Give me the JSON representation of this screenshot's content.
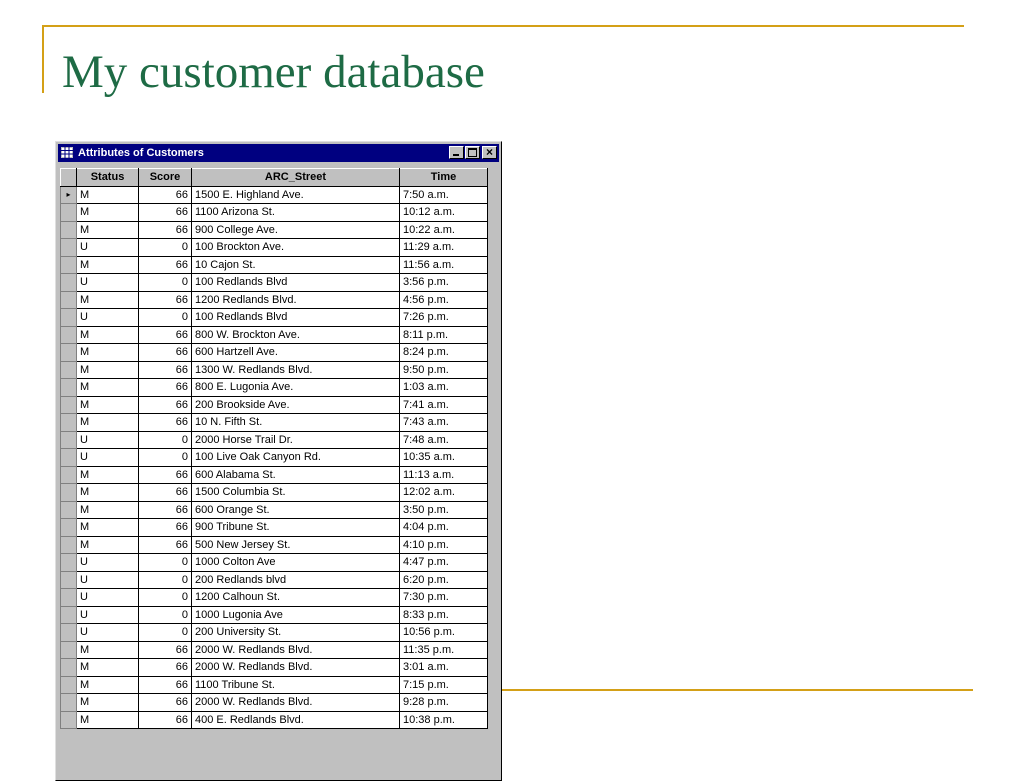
{
  "slide": {
    "title": "My customer database"
  },
  "window": {
    "title": "Attributes of Customers",
    "close_glyph": "×"
  },
  "table": {
    "columns": [
      "Status",
      "Score",
      "ARC_Street",
      "Time"
    ],
    "current_row_marker": "▸",
    "rows": [
      [
        "M",
        "66",
        "1500  E. Highland Ave.",
        "7:50 a.m."
      ],
      [
        "M",
        "66",
        "1100  Arizona St.",
        "10:12 a.m."
      ],
      [
        "M",
        "66",
        "900  College Ave.",
        "10:22 a.m."
      ],
      [
        "U",
        "0",
        "100 Brockton Ave.",
        "11:29 a.m."
      ],
      [
        "M",
        "66",
        "10  Cajon St.",
        "11:56 a.m."
      ],
      [
        "U",
        "0",
        "100 Redlands Blvd",
        "3:56 p.m."
      ],
      [
        "M",
        "66",
        "1200 Redlands Blvd.",
        "4:56 p.m."
      ],
      [
        "U",
        "0",
        "100 Redlands Blvd",
        "7:26 p.m."
      ],
      [
        "M",
        "66",
        "800  W. Brockton Ave.",
        "8:11 p.m."
      ],
      [
        "M",
        "66",
        "600 Hartzell Ave.",
        "8:24 p.m."
      ],
      [
        "M",
        "66",
        "1300  W. Redlands Blvd.",
        "9:50 p.m."
      ],
      [
        "M",
        "66",
        "800  E. Lugonia Ave.",
        "1:03 a.m."
      ],
      [
        "M",
        "66",
        "200 Brookside Ave.",
        "7:41 a.m."
      ],
      [
        "M",
        "66",
        "10  N. Fifth St.",
        "7:43 a.m."
      ],
      [
        "U",
        "0",
        "2000  Horse Trail Dr.",
        "7:48 a.m."
      ],
      [
        "U",
        "0",
        "100 Live Oak Canyon Rd.",
        "10:35 a.m."
      ],
      [
        "M",
        "66",
        "600  Alabama St.",
        "11:13 a.m."
      ],
      [
        "M",
        "66",
        "1500  Columbia St.",
        "12:02 a.m."
      ],
      [
        "M",
        "66",
        "600  Orange St.",
        "3:50 p.m."
      ],
      [
        "M",
        "66",
        "900  Tribune St.",
        "4:04 p.m."
      ],
      [
        "M",
        "66",
        "500  New Jersey St.",
        "4:10 p.m."
      ],
      [
        "U",
        "0",
        "1000 Colton Ave",
        "4:47 p.m."
      ],
      [
        "U",
        "0",
        "200 Redlands blvd",
        "6:20 p.m."
      ],
      [
        "U",
        "0",
        "1200 Calhoun St.",
        "7:30 p.m."
      ],
      [
        "U",
        "0",
        "1000 Lugonia Ave",
        "8:33 p.m."
      ],
      [
        "U",
        "0",
        "200 University St.",
        "10:56 p.m."
      ],
      [
        "M",
        "66",
        "2000 W. Redlands Blvd.",
        "11:35 p.m."
      ],
      [
        "M",
        "66",
        "2000 W. Redlands Blvd.",
        "3:01 a.m."
      ],
      [
        "M",
        "66",
        "1100 Tribune St.",
        "7:15 p.m."
      ],
      [
        "M",
        "66",
        "2000 W. Redlands Blvd.",
        "9:28 p.m."
      ],
      [
        "M",
        "66",
        "400 E. Redlands Blvd.",
        "10:38 p.m."
      ]
    ]
  },
  "colors": {
    "title_green": "#1e6b45",
    "rule_gold": "#d4a017",
    "titlebar_navy": "#000080"
  }
}
